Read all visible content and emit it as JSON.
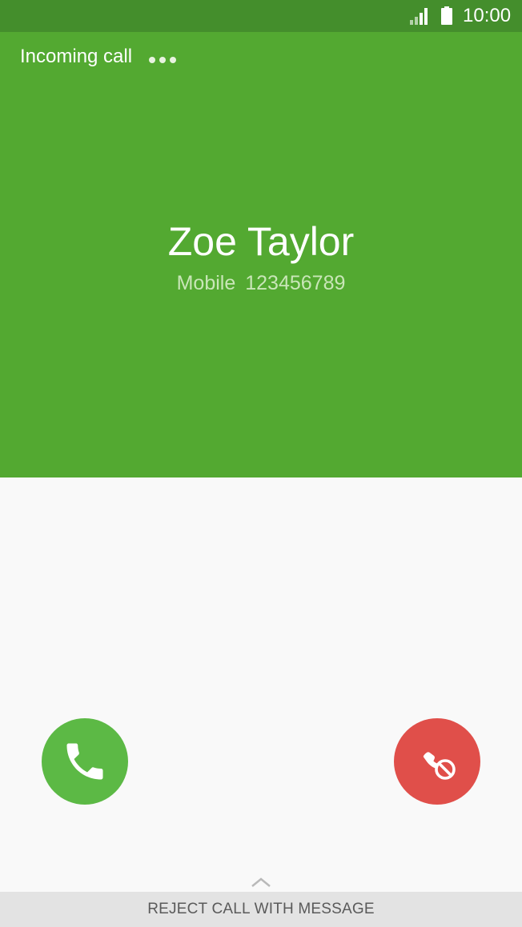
{
  "status_bar": {
    "time": "10:00",
    "icons": [
      "signal-icon",
      "battery-icon"
    ]
  },
  "call": {
    "status_label": "Incoming call",
    "caller_name": "Zoe Taylor",
    "number_type": "Mobile",
    "number": "123456789"
  },
  "actions": {
    "answer_icon": "phone-icon",
    "reject_icon": "phone-reject-icon",
    "reject_with_message_label": "REJECT CALL WITH MESSAGE"
  },
  "colors": {
    "status_bar": "#448e2c",
    "header": "#53a931",
    "answer": "#5cb945",
    "reject": "#e04f4a",
    "background": "#f9f9f9"
  }
}
